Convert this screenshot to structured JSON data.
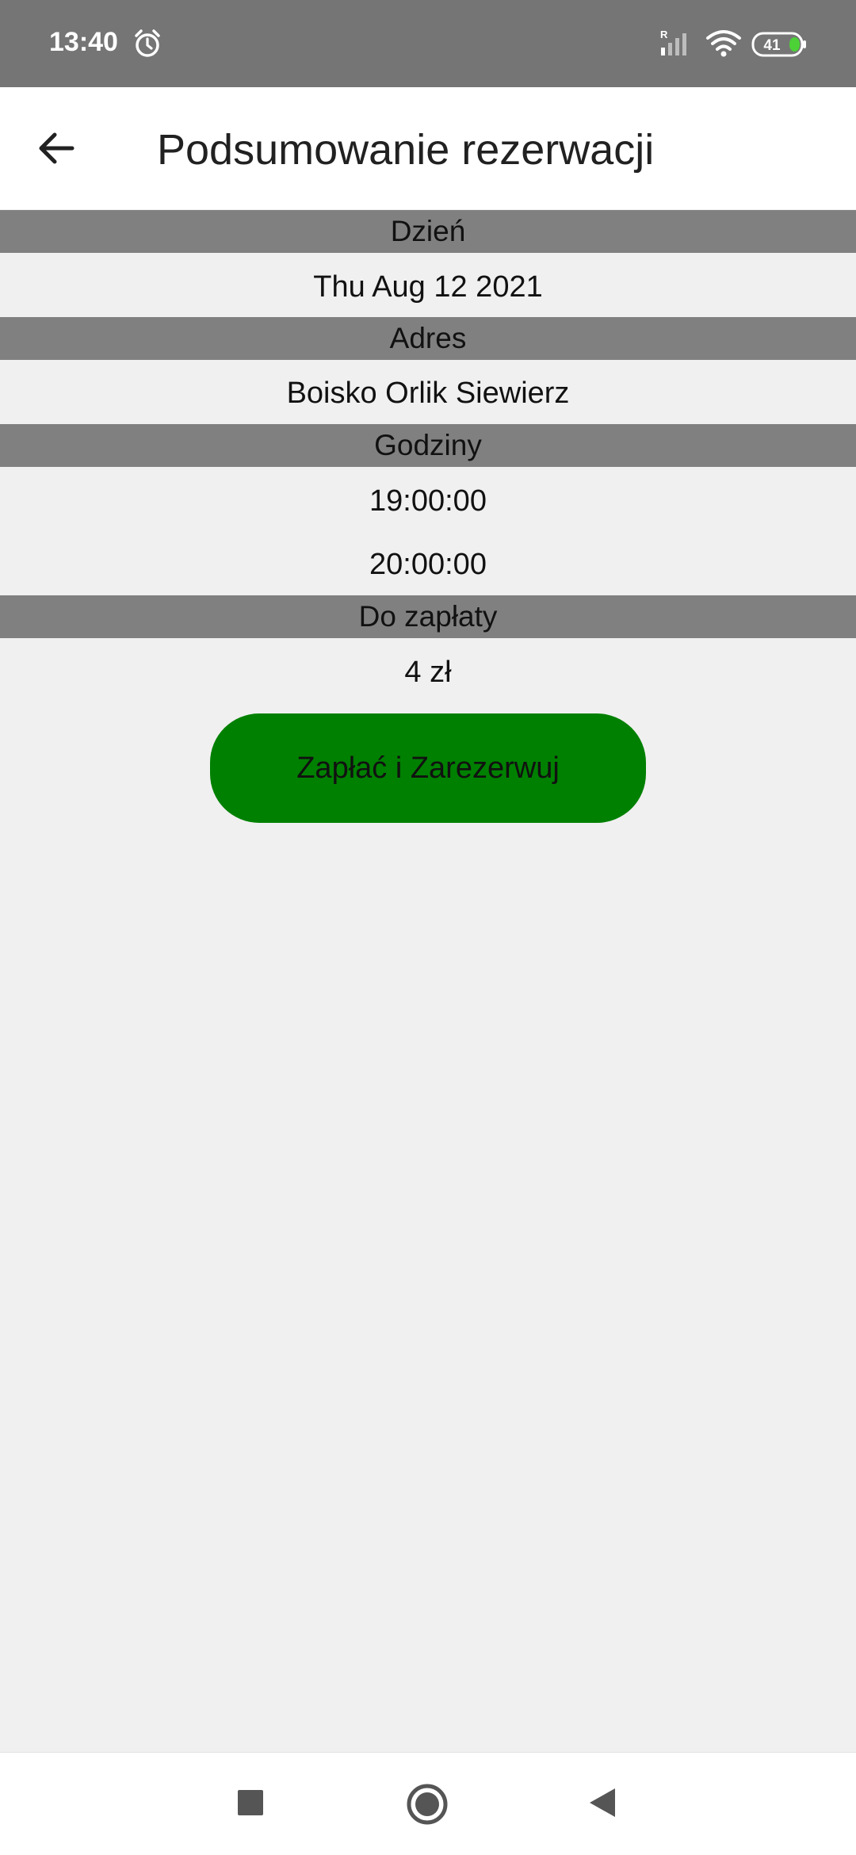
{
  "status_bar": {
    "time": "13:40",
    "battery_level": "41",
    "roaming_indicator": "R",
    "icons": [
      "alarm-icon",
      "signal-icon",
      "wifi-icon",
      "battery-icon"
    ]
  },
  "app_bar": {
    "title": "Podsumowanie rezerwacji",
    "back_icon": "arrow-left-icon"
  },
  "summary": {
    "day_label": "Dzień",
    "day_value": "Thu Aug 12 2021",
    "address_label": "Adres",
    "address_value": "Boisko Orlik Siewierz",
    "hours_label": "Godziny",
    "hours": [
      "19:00:00",
      "20:00:00"
    ],
    "payment_label": "Do zapłaty",
    "payment_value": "4 zł"
  },
  "pay_button": {
    "label": "Zapłać i Zarezerwuj"
  },
  "nav_bar": {
    "icons": [
      "recents-icon",
      "home-icon",
      "back-icon"
    ]
  },
  "colors": {
    "status_bar": "#757575",
    "section_header": "#808080",
    "background": "#f0f0f0",
    "pay_button": "#008000"
  }
}
